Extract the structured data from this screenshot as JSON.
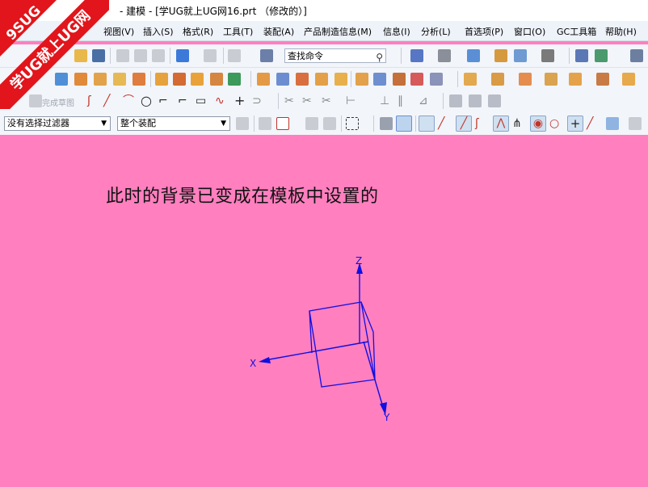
{
  "window": {
    "title": "- 建模 - [学UG就上UG网16.prt （修改的）]"
  },
  "watermark": {
    "brand_line1": "9SUG",
    "brand_line2": "学UG就上UG网"
  },
  "menu": {
    "items": [
      "视图(V)",
      "插入(S)",
      "格式(R)",
      "工具(T)",
      "装配(A)",
      "产品制造信息(M)",
      "信息(I)",
      "分析(L)",
      "首选项(P)",
      "窗口(O)",
      "GC工具箱",
      "帮助(H)"
    ]
  },
  "toolbar": {
    "search_value": "查找命令",
    "finish_sketch_label": "完成草图",
    "filter_select": "没有选择过滤器",
    "assembly_select": "整个装配"
  },
  "canvas": {
    "caption": "此时的背景已变成在模板中设置的",
    "background_color": "#ff7fbf",
    "axis_labels": {
      "x": "X",
      "y": "Y",
      "z": "Z"
    }
  }
}
